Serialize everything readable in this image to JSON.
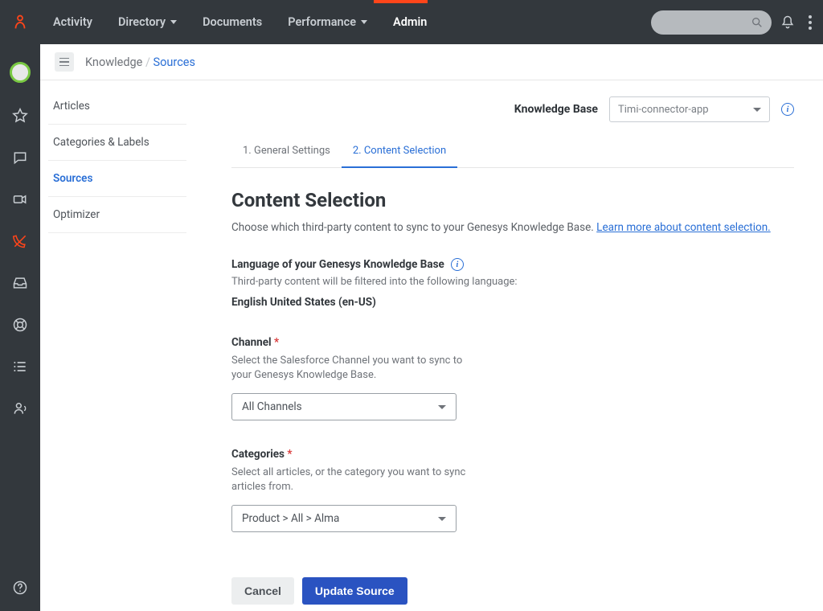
{
  "topnav": {
    "items": [
      {
        "label": "Activity"
      },
      {
        "label": "Directory"
      },
      {
        "label": "Documents"
      },
      {
        "label": "Performance"
      },
      {
        "label": "Admin"
      }
    ]
  },
  "breadcrumb": {
    "root": "Knowledge",
    "current": "Sources"
  },
  "sidenav": {
    "items": [
      {
        "label": "Articles"
      },
      {
        "label": "Categories & Labels"
      },
      {
        "label": "Sources"
      },
      {
        "label": "Optimizer"
      }
    ]
  },
  "kb": {
    "label": "Knowledge Base",
    "value": "Timi-connector-app"
  },
  "tabs": [
    {
      "label": "1. General Settings"
    },
    {
      "label": "2. Content Selection"
    }
  ],
  "page": {
    "title": "Content Selection",
    "lead_pre": "Choose which third-party content to sync to your Genesys Knowledge Base. ",
    "lead_link": "Learn more about content selection.",
    "lang_title": "Language of your Genesys Knowledge Base",
    "lang_help": "Third-party content will be filtered into the following language:",
    "lang_value": "English United States (en-US)",
    "channel_label": "Channel",
    "channel_help": "Select the Salesforce Channel you want to sync to your Genesys Knowledge Base.",
    "channel_value": "All Channels",
    "categories_label": "Categories",
    "categories_help": "Select all articles, or the category you want to sync articles from.",
    "categories_value": "Product > All > Alma",
    "cancel": "Cancel",
    "submit": "Update Source"
  }
}
